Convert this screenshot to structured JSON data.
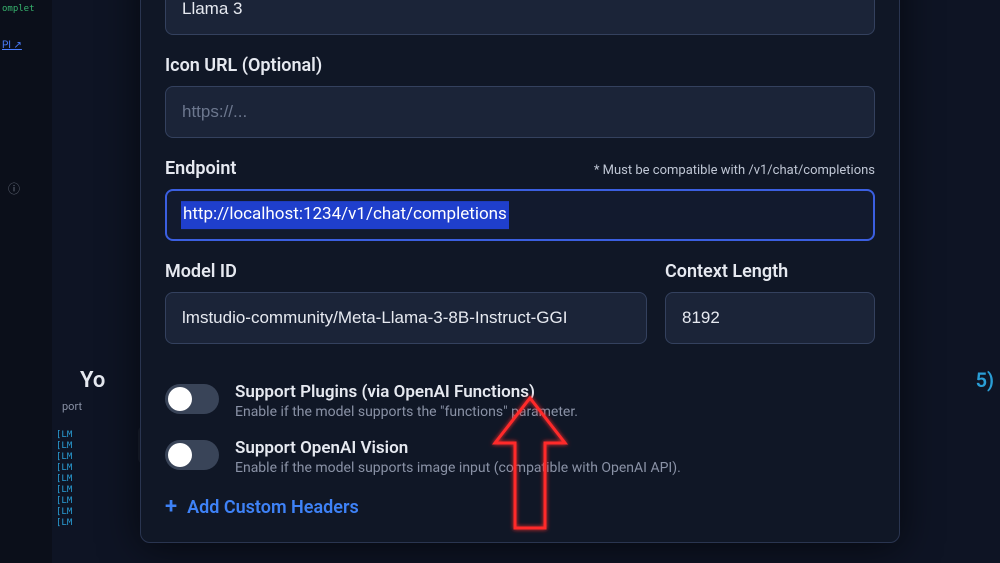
{
  "left": {
    "fragment": "omplet",
    "link": "PI ↗",
    "info_glyph": "ⓘ"
  },
  "background": {
    "heading": "Yo",
    "port": "port",
    "lm_prefix": "[LM",
    "right_num": "5)"
  },
  "form": {
    "name_value": "Llama 3",
    "icon_url_label": "Icon URL (Optional)",
    "icon_url_placeholder": "https://...",
    "endpoint_label": "Endpoint",
    "endpoint_hint": "* Must be compatible with /v1/chat/completions",
    "endpoint_value": "http://localhost:1234/v1/chat/completions",
    "model_id_label": "Model ID",
    "model_id_value": "lmstudio-community/Meta-Llama-3-8B-Instruct-GGI",
    "context_length_label": "Context Length",
    "context_length_value": "8192",
    "support_plugins_title": "Support Plugins (via OpenAI Functions)",
    "support_plugins_sub": "Enable if the model supports the \"functions\" parameter.",
    "support_vision_title": "Support OpenAI Vision",
    "support_vision_sub": "Enable if the model supports image input (compatible with OpenAI API).",
    "add_headers": "Add Custom Headers"
  }
}
